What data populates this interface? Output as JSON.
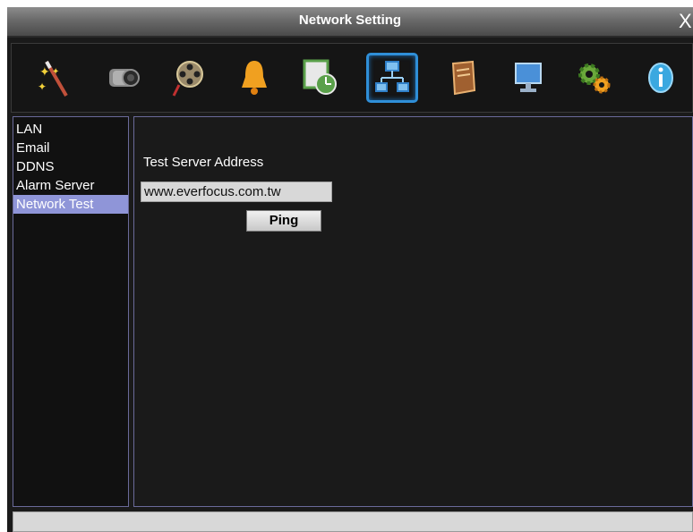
{
  "window": {
    "title": "Network Setting",
    "close_glyph": "X"
  },
  "toolbar": {
    "icons": [
      {
        "name": "magic-wand-icon"
      },
      {
        "name": "camera-icon"
      },
      {
        "name": "film-reel-icon"
      },
      {
        "name": "bell-icon"
      },
      {
        "name": "schedule-clock-icon"
      },
      {
        "name": "network-icon",
        "active": true
      },
      {
        "name": "book-icon"
      },
      {
        "name": "monitor-icon"
      },
      {
        "name": "gears-icon"
      },
      {
        "name": "info-icon"
      }
    ]
  },
  "sidebar": {
    "items": [
      {
        "label": "LAN"
      },
      {
        "label": "Email"
      },
      {
        "label": "DDNS"
      },
      {
        "label": "Alarm Server"
      },
      {
        "label": "Network Test",
        "selected": true
      }
    ]
  },
  "main": {
    "field_label": "Test Server Address",
    "address_value": "www.everfocus.com.tw",
    "ping_label": "Ping"
  },
  "colors": {
    "selection": "#8f95d8",
    "active_icon_border": "#2f8fd8",
    "background": "#1a1a1a"
  }
}
